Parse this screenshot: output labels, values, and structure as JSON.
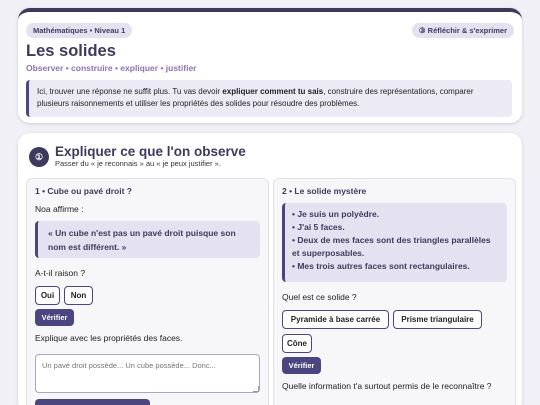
{
  "header": {
    "level_tag": "Mathématiques • Niveau 1",
    "mode_tag": "③ Réfléchir & s'exprimer",
    "title": "Les solides",
    "subtitle": "Observer • construire • expliquer • justifier",
    "intro_before": "Ici, trouver une réponse ne suffit plus. Tu vas devoir ",
    "intro_bold": "expliquer comment tu sais",
    "intro_after": ", construire des représentations, comparer plusieurs raisonnements et utiliser les propriétés des solides pour résoudre des problèmes."
  },
  "section": {
    "badge": "①",
    "title": "Expliquer ce que l'on observe",
    "subtitle": "Passer du « je reconnais » au « je peux justifier »."
  },
  "q1": {
    "title": "1 • Cube ou pavé droit ?",
    "intro": "Noa affirme :",
    "quote": "« Un cube n'est pas un pavé droit puisque son nom est différent. »",
    "question": "A-t-il raison ?",
    "options": [
      "Oui",
      "Non"
    ],
    "verify_label": "Vérifier",
    "explain_prompt": "Explique avec les propriétés des faces.",
    "answer_placeholder": "Un pavé droit possède... Un cube possède... Donc..."
  },
  "q2": {
    "title": "2 • Le solide mystère",
    "clues": [
      "Je suis un polyèdre.",
      "J'ai 5 faces.",
      "Deux de mes faces sont des triangles parallèles et superposables.",
      "Mes trois autres faces sont rectangulaires."
    ],
    "question": "Quel est ce solide ?",
    "options": [
      "Pyramide à base carrée",
      "Prisme triangulaire",
      "Cône"
    ],
    "verify_label": "Vérifier",
    "followup": "Quelle information t'a surtout permis de le reconnaître ?"
  }
}
